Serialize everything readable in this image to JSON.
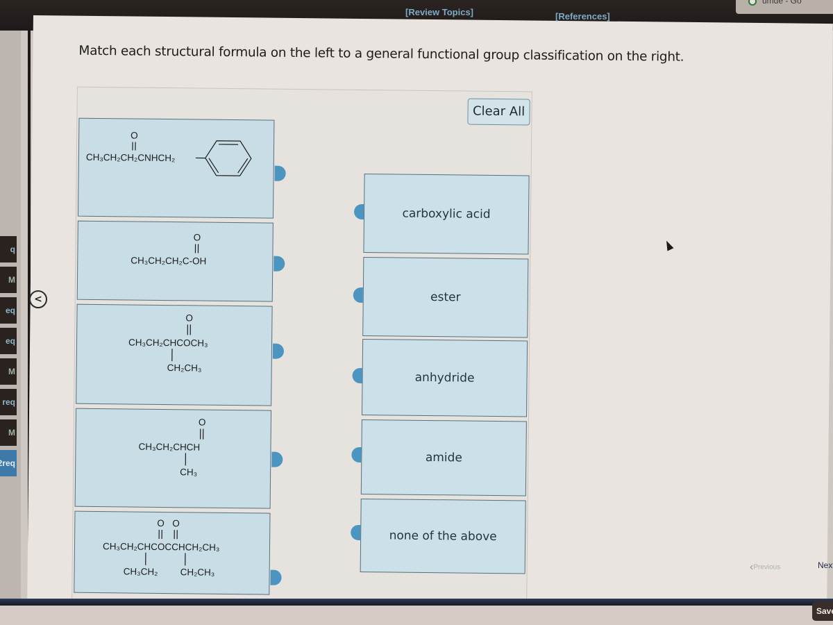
{
  "header": {
    "review_topics": "[Review Topics]",
    "references": "[References]",
    "top_right_text": "umde - Go"
  },
  "left_nav": {
    "items": [
      {
        "label": "q",
        "type": "text"
      },
      {
        "label": "M",
        "type": "badge"
      },
      {
        "label": "eq",
        "type": "text"
      },
      {
        "label": "eq",
        "type": "text"
      },
      {
        "label": "M",
        "type": "badge"
      },
      {
        "label": "req",
        "type": "text"
      },
      {
        "label": "M",
        "type": "badge"
      },
      {
        "label": "2req",
        "type": "text",
        "active": true
      }
    ],
    "collapse_icon": "chevron-left-icon",
    "collapse_glyph": "<"
  },
  "question": {
    "instruction": "Match each structural formula on the left to a general functional group classification on the right.",
    "clear_all": "Clear All",
    "structures": [
      {
        "id": "s1",
        "formula": "CH3CH2CH2C(=O)NHCH2-C6H5",
        "main": "CH₃CH₂CH₂CNHCH₂",
        "carbonyl": "O",
        "ring": "benzene"
      },
      {
        "id": "s2",
        "formula": "CH3CH2CH2C(=O)-OH",
        "main": "CH₃CH₂CH₂C-OH",
        "carbonyl": "O"
      },
      {
        "id": "s3",
        "formula": "CH3CH2CH(CH2CH3)C(=O)OCH3",
        "main": "CH₃CH₂CHCOCH₃",
        "carbonyl": "O",
        "branch": "CH₂CH₃"
      },
      {
        "id": "s4",
        "formula": "CH3CH2CH(CH3)C(=O)H",
        "main": "CH₃CH₂CHCH",
        "carbonyl": "O",
        "branch": "CH₃"
      },
      {
        "id": "s5",
        "formula": "CH3CH2CH(CH2CH3)C(=O)OC(=O)CH(CH2CH3)CH2CH3",
        "main": "CH₃CH₂CHCOCCHCH₂CH₃",
        "carbonyl": "O   O",
        "branch_left": "CH₃CH₂",
        "branch_right": "CH₂CH₃"
      }
    ],
    "classifications": [
      {
        "id": "c1",
        "label": "carboxylic acid"
      },
      {
        "id": "c2",
        "label": "ester"
      },
      {
        "id": "c3",
        "label": "anhydride"
      },
      {
        "id": "c4",
        "label": "amide"
      },
      {
        "id": "c5",
        "label": "none of the above"
      }
    ],
    "connector_color": "#4b95c0"
  },
  "navigation": {
    "previous": "Previous",
    "next": "Next",
    "save": "Save"
  }
}
